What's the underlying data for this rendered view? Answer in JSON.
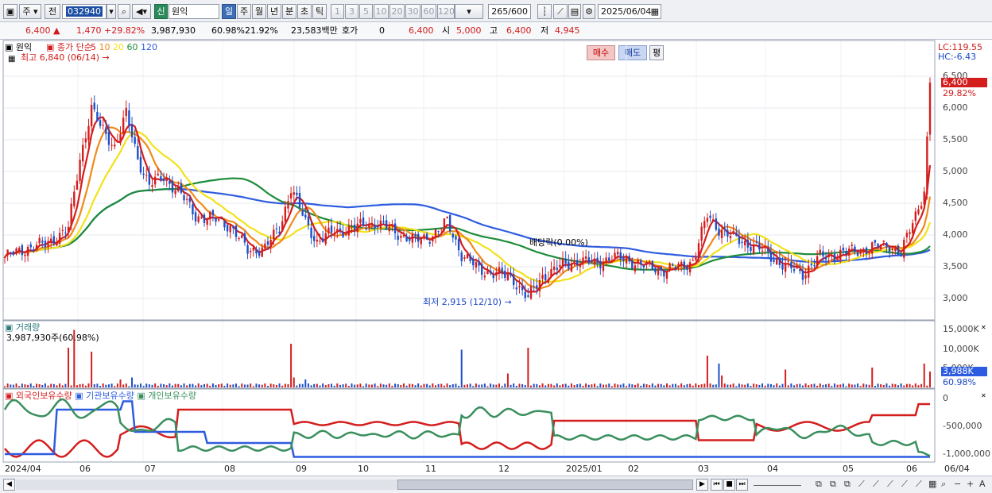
{
  "toolbar": {
    "market_label": "주",
    "prev_label": "전",
    "stock_code": "032940",
    "new_badge": "신",
    "stock_name": "원익",
    "periods": [
      "일",
      "주",
      "월",
      "년",
      "분",
      "초",
      "틱"
    ],
    "minute_options": [
      "1",
      "3",
      "5",
      "10",
      "20",
      "30",
      "60",
      "120"
    ],
    "count_current": "265",
    "count_max": "/600",
    "date": "2025/06/04"
  },
  "quote": {
    "price": "6,400",
    "change": "1,470",
    "change_rate": "+29.82%",
    "volume": "3,987,930",
    "volume_rate": "60.98%",
    "turnover": "21.92%",
    "amount": "23,583백만",
    "hoga_label": "호가",
    "hoga_value": "0",
    "hoga_price": "6,400",
    "open_label": "시",
    "open": "5,000",
    "high_label": "고",
    "high": "6,400",
    "low_label": "저",
    "low": "4,945",
    "buy_label": "매수",
    "sell_label": "매도",
    "eval_label": "평"
  },
  "price_panel": {
    "title": "원익",
    "ma_title": "종가 단순",
    "ma_periods": [
      "5",
      "10",
      "20",
      "60",
      "120"
    ],
    "ma_colors": [
      "#d41e1e",
      "#f08a1a",
      "#f2e21a",
      "#1e8c3a",
      "#2e5ce0"
    ],
    "high_note": "최고 6,840 (06/14)",
    "low_note": "최저 2,915 (12/10)",
    "dividend_note": "배당락(0.00%)",
    "lc": "LC:119.55",
    "hc": "HC:-6.43",
    "last_price_tag": "6,400",
    "last_change_tag": "29.82%",
    "y_ticks": [
      "6,500",
      "6,000",
      "5,500",
      "5,000",
      "4,500",
      "4,000",
      "3,500",
      "3,000"
    ]
  },
  "volume_panel": {
    "title": "거래량",
    "value": "3,987,930주(60.98%)",
    "y_ticks": [
      "15,000K",
      "10,000K",
      "5,000K"
    ],
    "tag_value": "3,988K",
    "tag_rate": "60.98%"
  },
  "holding_panel": {
    "series": [
      "외국인보유수량",
      "기관보유수량",
      "개인보유수량"
    ],
    "series_colors": [
      "#d41e1e",
      "#2e5ce0",
      "#3a8f5e"
    ],
    "y_ticks": [
      "0",
      "-500,000",
      "-1,000,000"
    ]
  },
  "x_axis": {
    "labels": [
      "2024/04",
      "06",
      "07",
      "08",
      "09",
      "10",
      "11",
      "12",
      "2025/01",
      "02",
      "03",
      "04",
      "05",
      "06",
      "06/04"
    ]
  }
}
